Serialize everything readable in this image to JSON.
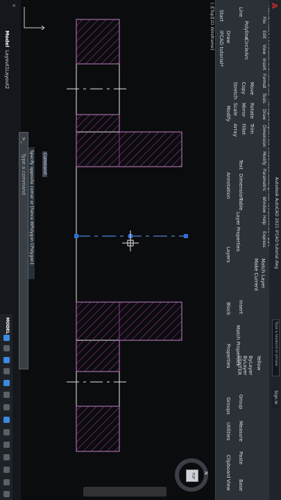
{
  "app": {
    "title": "Autodesk AutoCAD 2021",
    "file": "IFCAD tutorial.dwg",
    "title_full": "Autodesk AutoCAD 2021   IFCAD tutorial.dwg",
    "search_placeholder": "Type a keyword or phrase",
    "sign_in": "Sign In"
  },
  "menu": [
    "File",
    "Edit",
    "View",
    "Insert",
    "Format",
    "Tools",
    "Draw",
    "Dimension",
    "Modify",
    "Parametric",
    "Window",
    "Help",
    "Express"
  ],
  "ribbon_tabs": [
    "Home",
    "Insert",
    "Annotate",
    "Parametric",
    "View",
    "Manage",
    "Output",
    "Add-ins",
    "Collaborate",
    "Express Tools",
    "Featured Apps"
  ],
  "panels": {
    "draw": {
      "title": "Draw",
      "tools": [
        "Line",
        "Polyline",
        "Circle",
        "Arc"
      ]
    },
    "modify": {
      "title": "Modify",
      "tools": [
        "Move",
        "Rotate",
        "Trim",
        "Copy",
        "Mirror",
        "Fillet",
        "Stretch",
        "Scale",
        "Array"
      ]
    },
    "annotation": {
      "title": "Annotation",
      "tools": [
        "Text",
        "Dimension",
        "Table"
      ]
    },
    "layers": {
      "title": "Layers",
      "tools": [
        "Layer Properties",
        "Make Current",
        "Match Layer"
      ]
    },
    "block": {
      "title": "Block",
      "tools": [
        "Insert"
      ]
    },
    "properties": {
      "title": "Properties",
      "tools": [
        "Match Properties"
      ],
      "values": [
        "ByLayer",
        "ByLayer",
        "CENTER"
      ],
      "color": "Yellow"
    },
    "groups": {
      "title": "Groups",
      "tools": [
        "Group"
      ]
    },
    "utilities": {
      "title": "Utilities",
      "tools": [
        "Measure"
      ]
    },
    "clipboard": {
      "title": "Clipboard",
      "tools": [
        "Paste"
      ]
    },
    "view": {
      "title": "View",
      "tools": [
        "Base"
      ]
    }
  },
  "tabs": {
    "start": "Start",
    "doc": "IFCAD tutorial*"
  },
  "viewport_label": "[-][Top][2D Wireframe]",
  "command": {
    "history1": "Specify opposite corner or [Fence WPolygon CPolygon]:",
    "prompt": "Type a command",
    "command_label": "Command:"
  },
  "layout_tabs": [
    "Model",
    "Layout1",
    "Layout2"
  ],
  "status_model": "MODEL",
  "navcube_face": "TOP",
  "compass": "N",
  "colors": {
    "ribbon_bg": "#2c3138",
    "outline": "#e8e8e8",
    "hatch": "#b03fae",
    "centerline": "#e8e8e8",
    "grip": "#2f6fd6",
    "accent_logo": "#c8272d"
  }
}
